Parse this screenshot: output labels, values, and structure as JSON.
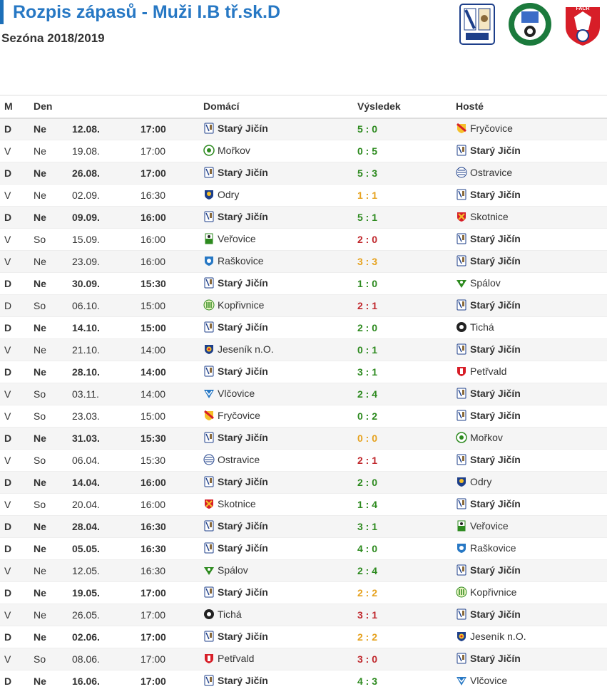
{
  "header": {
    "title": "Rozpis zápasů - Muži I.B tř.sk.D",
    "season": "Sezóna 2018/2019"
  },
  "logos": [
    "club-logo",
    "regional-fa-logo",
    "facr-logo"
  ],
  "columns": [
    "M",
    "Den",
    "",
    "",
    "Domácí",
    "Výsledek",
    "Hosté"
  ],
  "colors": {
    "win": "#2d8a1f",
    "loss": "#c0282d",
    "draw": "#e6a21f",
    "accent": "#2778c4"
  },
  "matches": [
    {
      "m": "D",
      "den": "Ne",
      "date": "12.08.",
      "time": "17:00",
      "home": "Starý Jičín",
      "score": "5 : 0",
      "away": "Fryčovice",
      "outcome": "win",
      "hc": "stary",
      "ac": "frycovice"
    },
    {
      "m": "V",
      "den": "Ne",
      "date": "19.08.",
      "time": "17:00",
      "home": "Mořkov",
      "score": "0 : 5",
      "away": "Starý Jičín",
      "outcome": "win",
      "hc": "morkov",
      "ac": "stary"
    },
    {
      "m": "D",
      "den": "Ne",
      "date": "26.08.",
      "time": "17:00",
      "home": "Starý Jičín",
      "score": "5 : 3",
      "away": "Ostravice",
      "outcome": "win",
      "hc": "stary",
      "ac": "ostravice"
    },
    {
      "m": "V",
      "den": "Ne",
      "date": "02.09.",
      "time": "16:30",
      "home": "Odry",
      "score": "1 : 1",
      "away": "Starý Jičín",
      "outcome": "draw",
      "hc": "odry",
      "ac": "stary"
    },
    {
      "m": "D",
      "den": "Ne",
      "date": "09.09.",
      "time": "16:00",
      "home": "Starý Jičín",
      "score": "5 : 1",
      "away": "Skotnice",
      "outcome": "win",
      "hc": "stary",
      "ac": "skotnice"
    },
    {
      "m": "V",
      "den": "So",
      "date": "15.09.",
      "time": "16:00",
      "home": "Veřovice",
      "score": "2 : 0",
      "away": "Starý Jičín",
      "outcome": "loss",
      "hc": "verovice",
      "ac": "stary"
    },
    {
      "m": "V",
      "den": "Ne",
      "date": "23.09.",
      "time": "16:00",
      "home": "Raškovice",
      "score": "3 : 3",
      "away": "Starý Jičín",
      "outcome": "draw",
      "hc": "raskovice",
      "ac": "stary"
    },
    {
      "m": "D",
      "den": "Ne",
      "date": "30.09.",
      "time": "15:30",
      "home": "Starý Jičín",
      "score": "1 : 0",
      "away": "Spálov",
      "outcome": "win",
      "hc": "stary",
      "ac": "spalov"
    },
    {
      "m": "D",
      "den": "So",
      "date": "06.10.",
      "time": "15:00",
      "home": "Kopřivnice",
      "score": "2 : 1",
      "away": "Starý Jičín",
      "outcome": "loss",
      "hc": "koprivnice",
      "ac": "stary",
      "plain": true
    },
    {
      "m": "D",
      "den": "Ne",
      "date": "14.10.",
      "time": "15:00",
      "home": "Starý Jičín",
      "score": "2 : 0",
      "away": "Tichá",
      "outcome": "win",
      "hc": "stary",
      "ac": "ticha"
    },
    {
      "m": "V",
      "den": "Ne",
      "date": "21.10.",
      "time": "14:00",
      "home": "Jeseník n.O.",
      "score": "0 : 1",
      "away": "Starý Jičín",
      "outcome": "win",
      "hc": "jesenik",
      "ac": "stary"
    },
    {
      "m": "D",
      "den": "Ne",
      "date": "28.10.",
      "time": "14:00",
      "home": "Starý Jičín",
      "score": "3 : 1",
      "away": "Petřvald",
      "outcome": "win",
      "hc": "stary",
      "ac": "petrvald"
    },
    {
      "m": "V",
      "den": "So",
      "date": "03.11.",
      "time": "14:00",
      "home": "Vlčovice",
      "score": "2 : 4",
      "away": "Starý Jičín",
      "outcome": "win",
      "hc": "vlcovice",
      "ac": "stary"
    },
    {
      "m": "V",
      "den": "So",
      "date": "23.03.",
      "time": "15:00",
      "home": "Fryčovice",
      "score": "0 : 2",
      "away": "Starý Jičín",
      "outcome": "win",
      "hc": "frycovice",
      "ac": "stary"
    },
    {
      "m": "D",
      "den": "Ne",
      "date": "31.03.",
      "time": "15:30",
      "home": "Starý Jičín",
      "score": "0 : 0",
      "away": "Mořkov",
      "outcome": "draw",
      "hc": "stary",
      "ac": "morkov"
    },
    {
      "m": "V",
      "den": "So",
      "date": "06.04.",
      "time": "15:30",
      "home": "Ostravice",
      "score": "2 : 1",
      "away": "Starý Jičín",
      "outcome": "loss",
      "hc": "ostravice",
      "ac": "stary"
    },
    {
      "m": "D",
      "den": "Ne",
      "date": "14.04.",
      "time": "16:00",
      "home": "Starý Jičín",
      "score": "2 : 0",
      "away": "Odry",
      "outcome": "win",
      "hc": "stary",
      "ac": "odry"
    },
    {
      "m": "V",
      "den": "So",
      "date": "20.04.",
      "time": "16:00",
      "home": "Skotnice",
      "score": "1 : 4",
      "away": "Starý Jičín",
      "outcome": "win",
      "hc": "skotnice",
      "ac": "stary"
    },
    {
      "m": "D",
      "den": "Ne",
      "date": "28.04.",
      "time": "16:30",
      "home": "Starý Jičín",
      "score": "3 : 1",
      "away": "Veřovice",
      "outcome": "win",
      "hc": "stary",
      "ac": "verovice"
    },
    {
      "m": "D",
      "den": "Ne",
      "date": "05.05.",
      "time": "16:30",
      "home": "Starý Jičín",
      "score": "4 : 0",
      "away": "Raškovice",
      "outcome": "win",
      "hc": "stary",
      "ac": "raskovice"
    },
    {
      "m": "V",
      "den": "Ne",
      "date": "12.05.",
      "time": "16:30",
      "home": "Spálov",
      "score": "2 : 4",
      "away": "Starý Jičín",
      "outcome": "win",
      "hc": "spalov",
      "ac": "stary"
    },
    {
      "m": "D",
      "den": "Ne",
      "date": "19.05.",
      "time": "17:00",
      "home": "Starý Jičín",
      "score": "2 : 2",
      "away": "Kopřivnice",
      "outcome": "draw",
      "hc": "stary",
      "ac": "koprivnice"
    },
    {
      "m": "V",
      "den": "Ne",
      "date": "26.05.",
      "time": "17:00",
      "home": "Tichá",
      "score": "3 : 1",
      "away": "Starý Jičín",
      "outcome": "loss",
      "hc": "ticha",
      "ac": "stary"
    },
    {
      "m": "D",
      "den": "Ne",
      "date": "02.06.",
      "time": "17:00",
      "home": "Starý Jičín",
      "score": "2 : 2",
      "away": "Jeseník n.O.",
      "outcome": "draw",
      "hc": "stary",
      "ac": "jesenik"
    },
    {
      "m": "V",
      "den": "So",
      "date": "08.06.",
      "time": "17:00",
      "home": "Petřvald",
      "score": "3 : 0",
      "away": "Starý Jičín",
      "outcome": "loss",
      "hc": "petrvald",
      "ac": "stary"
    },
    {
      "m": "D",
      "den": "Ne",
      "date": "16.06.",
      "time": "17:00",
      "home": "Starý Jičín",
      "score": "4 : 3",
      "away": "Vlčovice",
      "outcome": "win",
      "hc": "stary",
      "ac": "vlcovice"
    }
  ]
}
